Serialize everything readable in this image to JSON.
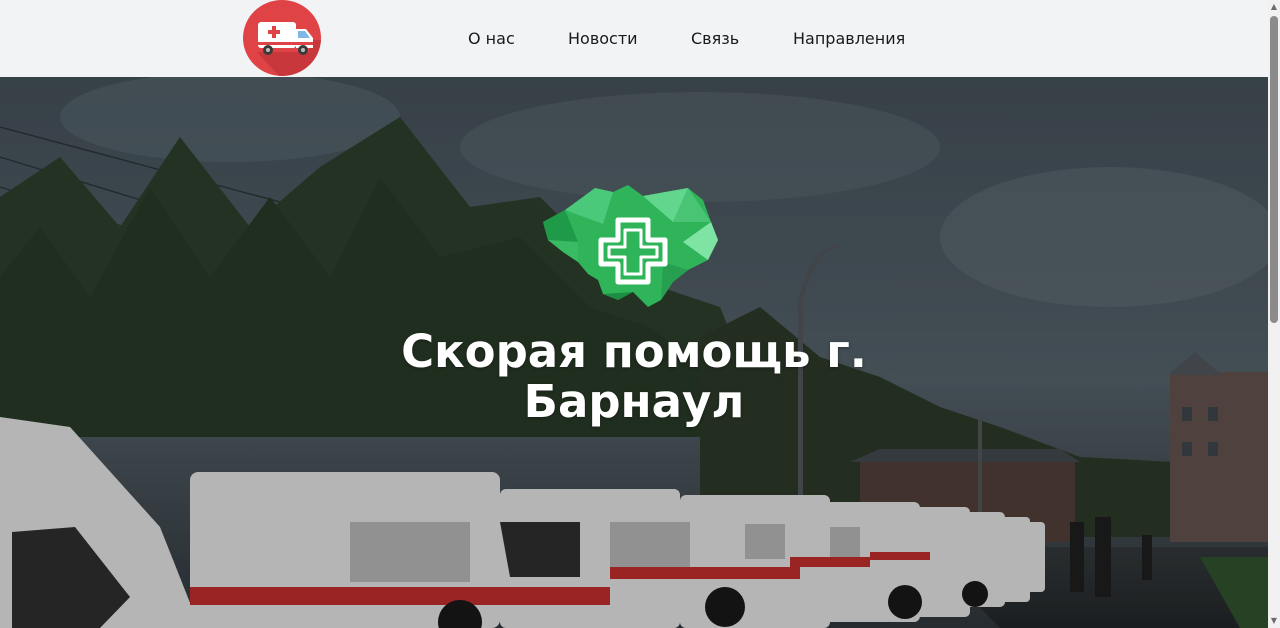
{
  "header": {
    "logo_icon": "ambulance-icon",
    "nav": [
      {
        "label": "О нас"
      },
      {
        "label": "Новости"
      },
      {
        "label": "Связь"
      },
      {
        "label": "Направления"
      }
    ]
  },
  "hero": {
    "emblem_icon": "medical-cross-map-icon",
    "title_line1": "Скорая помощь г.",
    "title_line2": "Барнаул",
    "background": "ambulance-fleet-photo"
  },
  "colors": {
    "header_bg": "#f2f3f5",
    "logo_red": "#e04346",
    "emblem_green": "#2fb45a",
    "title_text": "#ffffff"
  }
}
